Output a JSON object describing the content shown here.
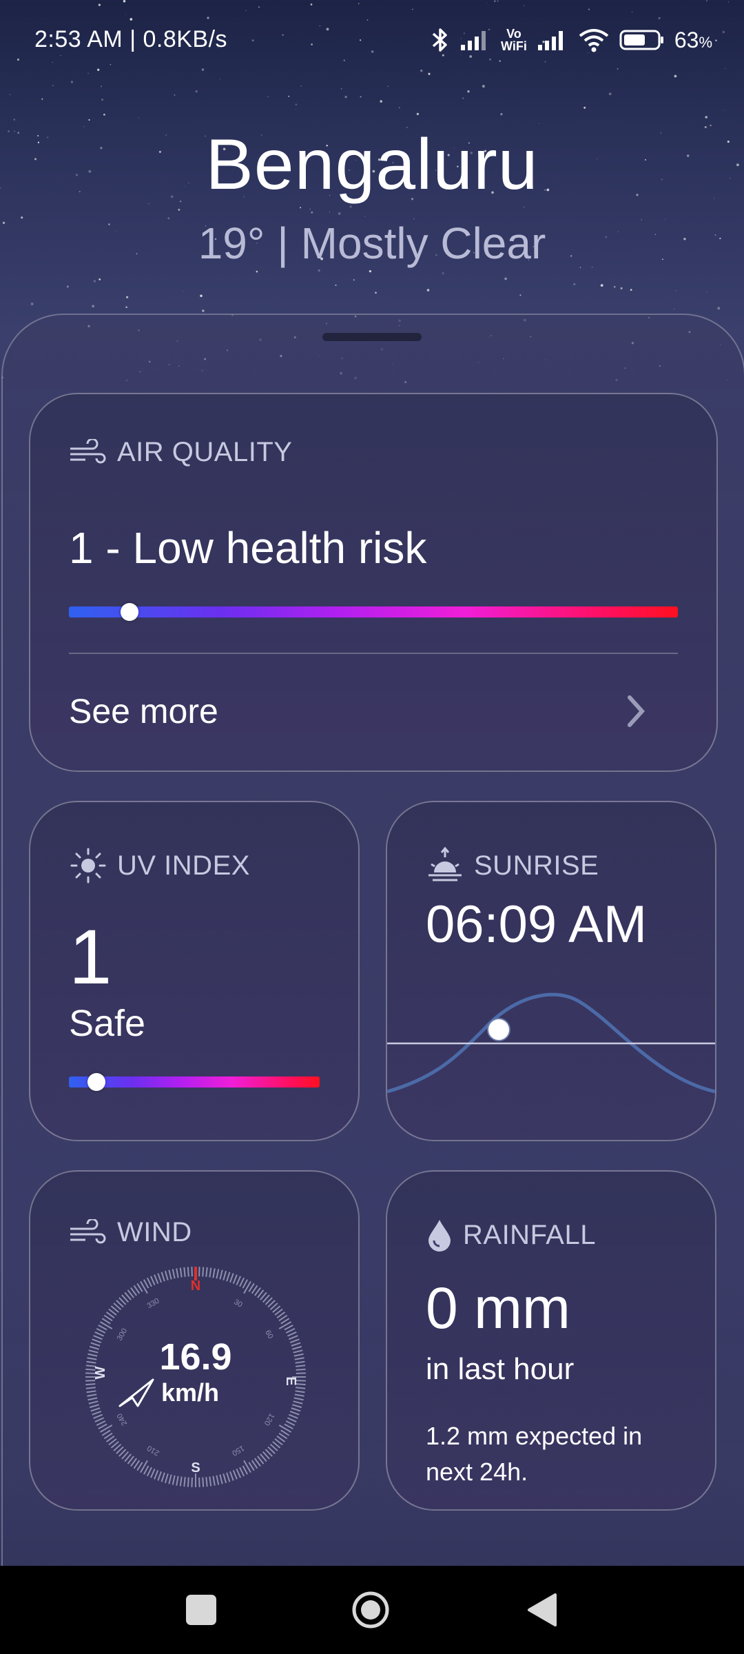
{
  "status_bar": {
    "time": "2:53 AM | 0.8KB/s",
    "battery_percent": "63",
    "battery_unit": "%",
    "wifi_label_top": "Vo",
    "wifi_label_bottom": "WiFi",
    "icons": [
      "bluetooth-icon",
      "signal-icon",
      "vowifi-icon",
      "signal-icon",
      "wifi-icon",
      "battery-icon"
    ]
  },
  "header": {
    "city": "Bengaluru",
    "condition": "19° | Mostly Clear"
  },
  "air_quality": {
    "title": "AIR QUALITY",
    "value": "1 - Low health risk",
    "level_fraction": 0.1,
    "see_more": "See more"
  },
  "uv_index": {
    "title": "UV INDEX",
    "value": "1",
    "label": "Safe",
    "level_fraction": 0.11
  },
  "sunrise": {
    "title": "SUNRISE",
    "time": "06:09 AM"
  },
  "wind": {
    "title": "WIND",
    "speed": "16.9",
    "unit": "km/h",
    "compass": {
      "north": "N",
      "east": "E",
      "south": "S",
      "west": "W",
      "degrees": [
        "30",
        "60",
        "120",
        "150",
        "210",
        "240",
        "300",
        "330"
      ]
    }
  },
  "rainfall": {
    "title": "RAINFALL",
    "amount": "0 mm",
    "period": "in last hour",
    "forecast": "1.2 mm expected in next 24h."
  },
  "nav": {
    "buttons": [
      "recents-button",
      "home-button",
      "back-button"
    ]
  },
  "colors": {
    "accent_north": "#e0302a",
    "knob": "#ffffff"
  }
}
